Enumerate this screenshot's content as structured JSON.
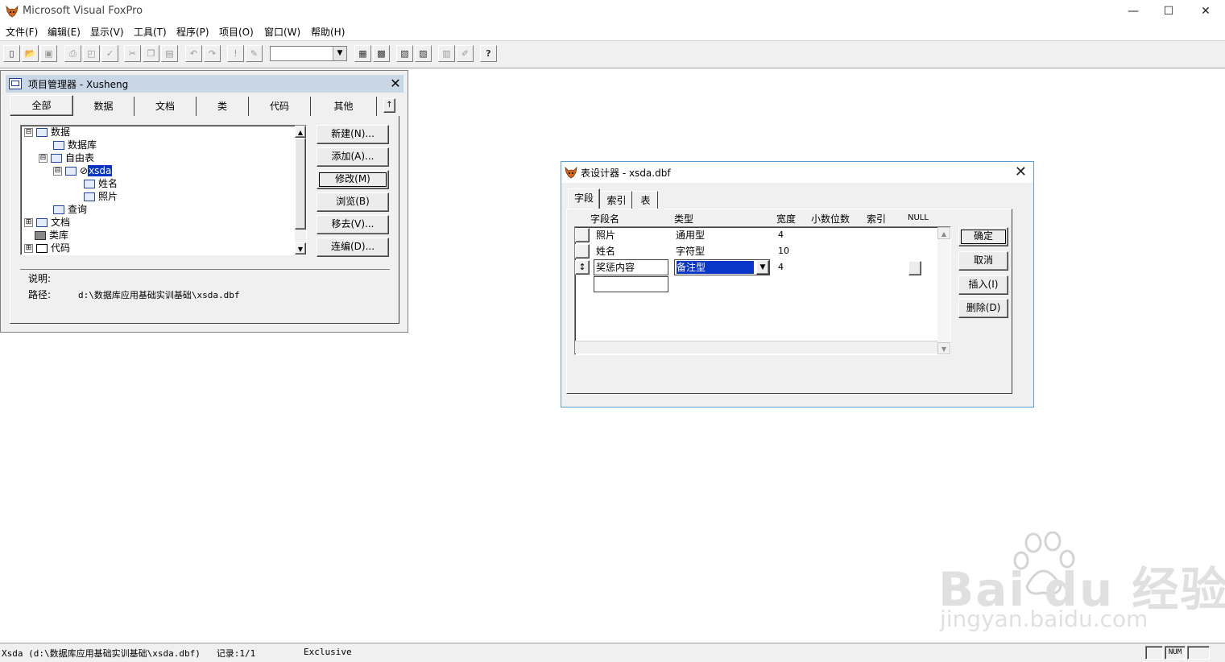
{
  "app": {
    "title": "Microsoft Visual FoxPro"
  },
  "window_controls": {
    "minimize": "—",
    "maximize": "☐",
    "close": "✕"
  },
  "menu": [
    "文件(F)",
    "编辑(E)",
    "显示(V)",
    "工具(T)",
    "程序(P)",
    "项目(O)",
    "窗口(W)",
    "帮助(H)"
  ],
  "toolbar": {
    "combo_value": "",
    "icons": [
      "new-file-icon",
      "open-icon",
      "save-icon",
      "print-icon",
      "print-preview-icon",
      "spell-check-icon",
      "cut-icon",
      "copy-icon",
      "paste-icon",
      "undo-icon",
      "redo-icon",
      "run-icon",
      "modify-form-icon",
      "database-icon",
      "form-wizard-icon",
      "report-icon",
      "query-icon",
      "command-window-icon",
      "properties-icon",
      "help-icon"
    ]
  },
  "project_manager": {
    "title": "项目管理器 - Xusheng",
    "close": "✕",
    "tabs": [
      "全部",
      "数据",
      "文档",
      "类",
      "代码",
      "其他"
    ],
    "tab_expand": "↑",
    "tree": [
      {
        "label": "数据",
        "exp": "⊟"
      },
      {
        "label": "数据库"
      },
      {
        "label": "自由表",
        "exp": "⊟"
      },
      {
        "label": "xsda",
        "exp": "⊟",
        "prefix": "⊘"
      },
      {
        "label": "姓名"
      },
      {
        "label": "照片"
      },
      {
        "label": "查询"
      },
      {
        "label": "文档",
        "exp": "⊞"
      },
      {
        "label": "类库"
      },
      {
        "label": "代码",
        "exp": "⊞"
      }
    ],
    "buttons": [
      "新建(N)...",
      "添加(A)...",
      "修改(M)",
      "浏览(B)",
      "移去(V)...",
      "连编(D)..."
    ],
    "info": {
      "desc_label": "说明:",
      "desc_value": "",
      "path_label": "路径:",
      "path_value": "d:\\数据库应用基础实训基础\\xsda.dbf"
    }
  },
  "table_designer": {
    "title": "表设计器 - xsda.dbf",
    "close": "✕",
    "tabs": [
      "字段",
      "索引",
      "表"
    ],
    "headers": [
      "字段名",
      "类型",
      "宽度",
      "小数位数",
      "索引",
      "NULL"
    ],
    "rows": [
      {
        "name": "照片",
        "type": "通用型",
        "width": "4"
      },
      {
        "name": "姓名",
        "type": "字符型",
        "width": "10"
      },
      {
        "name": "奖惩内容",
        "type": "备注型",
        "width": "4",
        "marker": "↕"
      }
    ],
    "buttons": [
      "确定",
      "取消",
      "插入(I)",
      "删除(D)"
    ]
  },
  "status": {
    "left": "Xsda (d:\\数据库应用基础实训基础\\xsda.dbf)   记录:1/1",
    "mode": "Exclusive",
    "num": "NUM"
  },
  "watermark": {
    "logo": "Bai du 经验",
    "url": "jingyan.baidu.com"
  }
}
